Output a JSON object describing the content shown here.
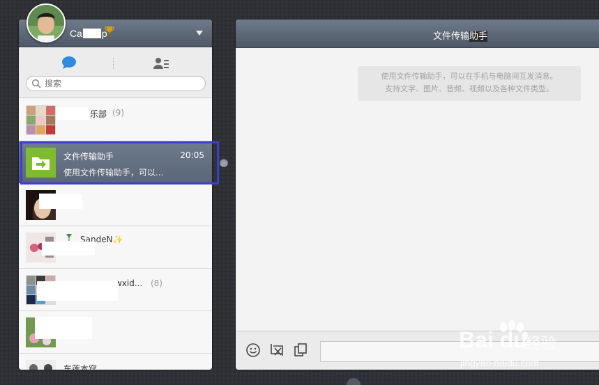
{
  "profile": {
    "name_prefix": "Ca",
    "name_suffix": "p"
  },
  "tabs": {
    "chat": "chat-icon",
    "contacts": "contacts-icon"
  },
  "search": {
    "placeholder": "搜索"
  },
  "chats": [
    {
      "title": "乐部",
      "count": "(9)"
    },
    {
      "title": "文件传输助手",
      "time": "20:05",
      "preview": "使用文件传输助手，可以..."
    },
    {
      "title": ""
    },
    {
      "title": "SandeN✨"
    },
    {
      "title": "wxid...",
      "count": "(8)"
    },
    {
      "title": ""
    },
    {
      "title": "车莲本穿"
    }
  ],
  "conversation": {
    "title_a": "文件传输",
    "title_b": "助手",
    "info_line1": "使用文件传输助手，可以在手机与电脑间互发消息。",
    "info_line2": "支持文字、图片、音频、视频以及各种文件类型。"
  },
  "composer": {
    "icons": [
      "emoji-icon",
      "screenshot-icon",
      "copy-icon"
    ]
  },
  "watermark": {
    "brand": "Bai du",
    "cn": "经验",
    "url": "jingyan.baidu.com"
  },
  "colors": {
    "header": "#5b6676",
    "highlight": "#3a3fd0",
    "file_helper_green": "#7dbb2f"
  }
}
